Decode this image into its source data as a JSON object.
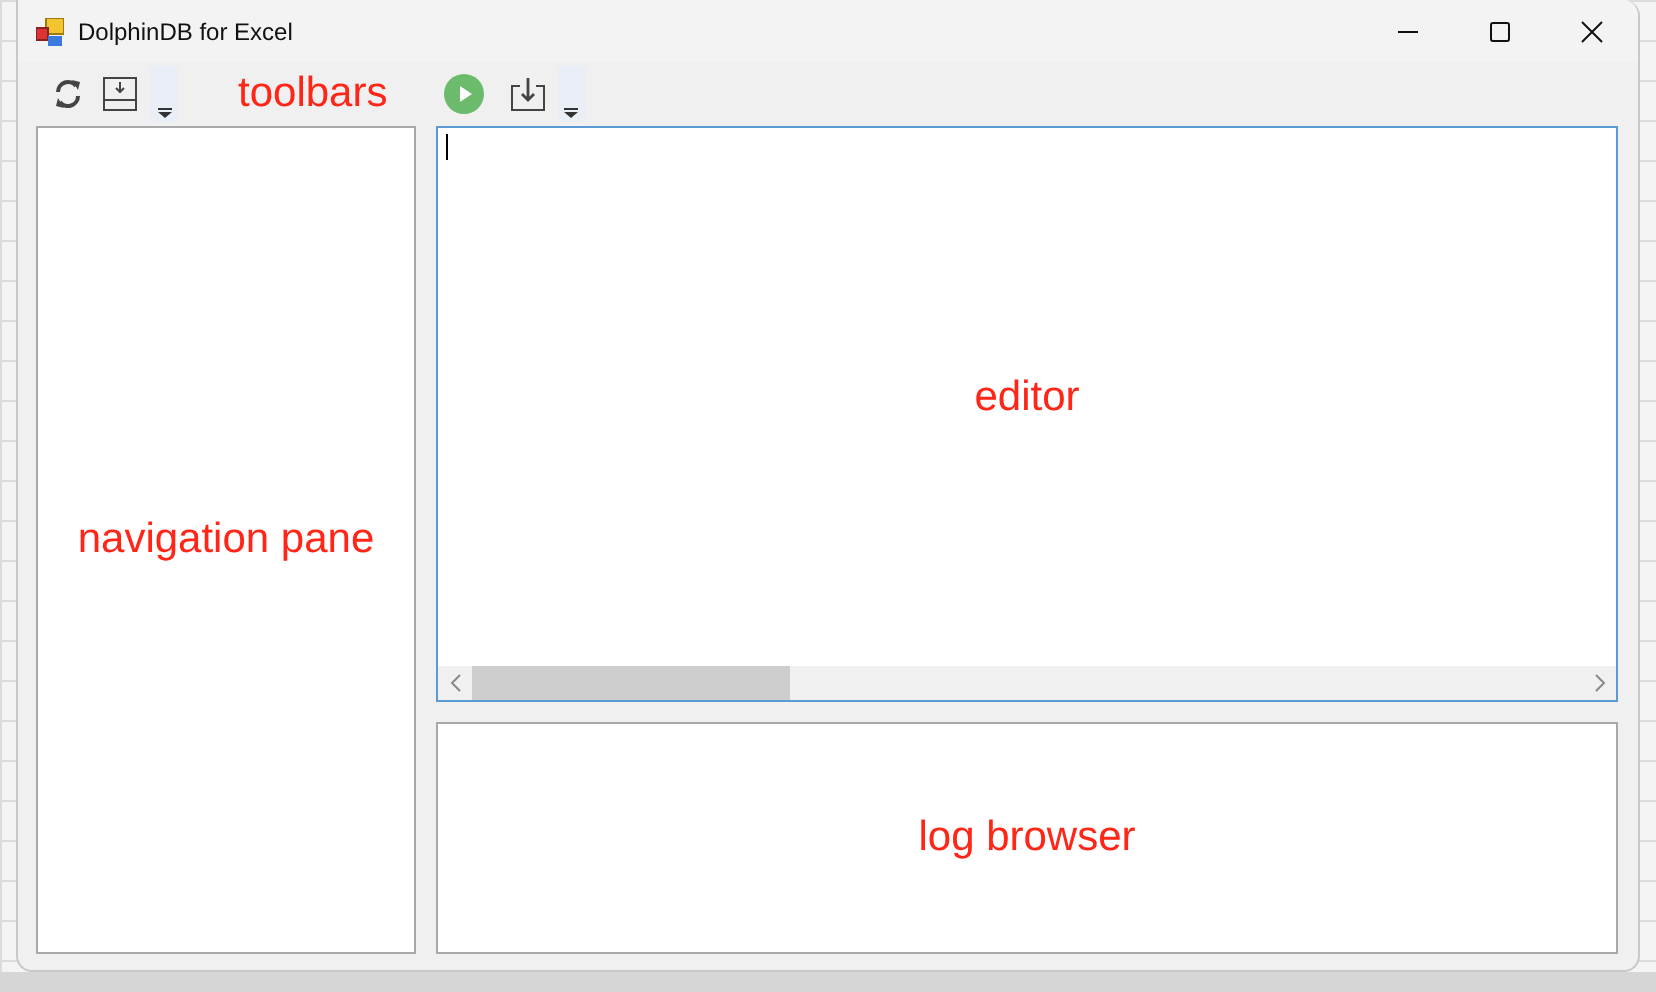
{
  "window": {
    "title": "DolphinDB for Excel"
  },
  "toolbars": {
    "annotation": "toolbars"
  },
  "navigation_pane": {
    "annotation": "navigation pane"
  },
  "editor": {
    "annotation": "editor"
  },
  "log_browser": {
    "annotation": "log browser"
  }
}
